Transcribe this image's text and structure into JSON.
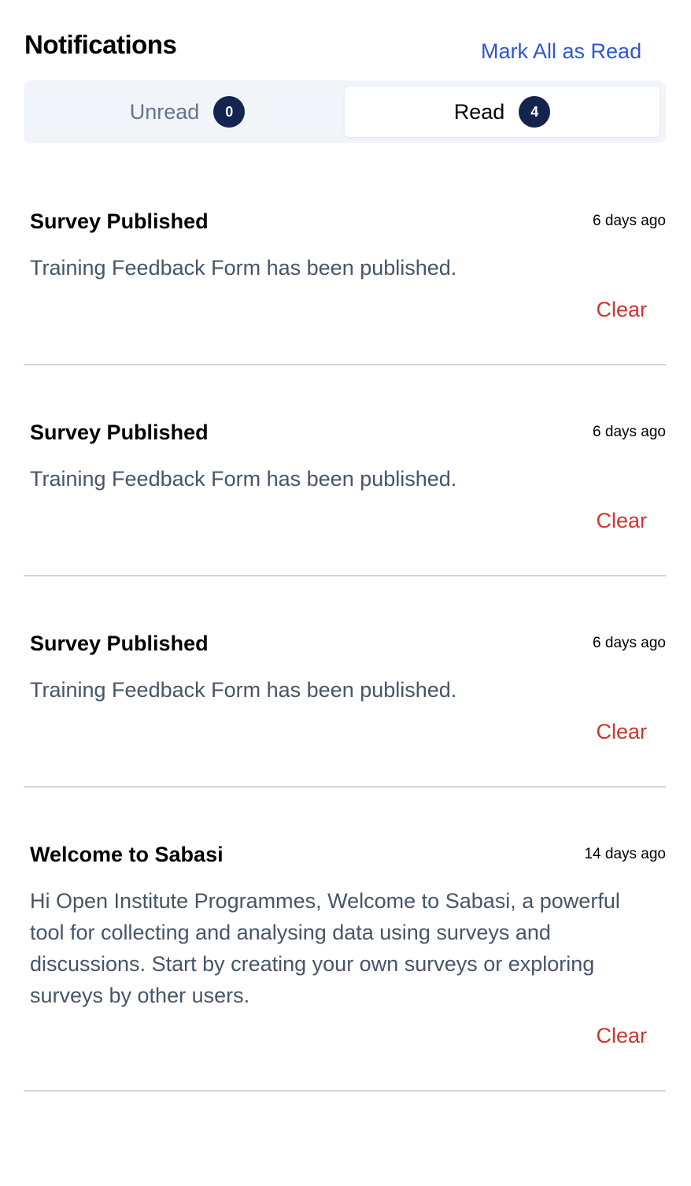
{
  "header": {
    "title": "Notifications",
    "mark_all_label": "Mark All as Read"
  },
  "tabs": [
    {
      "label": "Unread",
      "count": "0",
      "active": false
    },
    {
      "label": "Read",
      "count": "4",
      "active": true
    }
  ],
  "colors": {
    "accent_link": "#2f55d4",
    "badge_bg": "#14244f",
    "clear_red": "#d0342c",
    "tabs_bg": "#f1f5f9"
  },
  "notifications": [
    {
      "title": "Survey Published",
      "time": "6 days ago",
      "body": "Training Feedback Form has been published.",
      "clear_label": "Clear"
    },
    {
      "title": "Survey Published",
      "time": "6 days ago",
      "body": "Training Feedback Form has been published.",
      "clear_label": "Clear"
    },
    {
      "title": "Survey Published",
      "time": "6 days ago",
      "body": "Training Feedback Form has been published.",
      "clear_label": "Clear"
    },
    {
      "title": "Welcome to Sabasi",
      "time": "14 days ago",
      "body": "Hi Open Institute Programmes, Welcome to Sabasi, a powerful tool for collecting and analysing data using surveys and discussions. Start by creating your own surveys or exploring surveys by other users.",
      "clear_label": "Clear"
    }
  ]
}
